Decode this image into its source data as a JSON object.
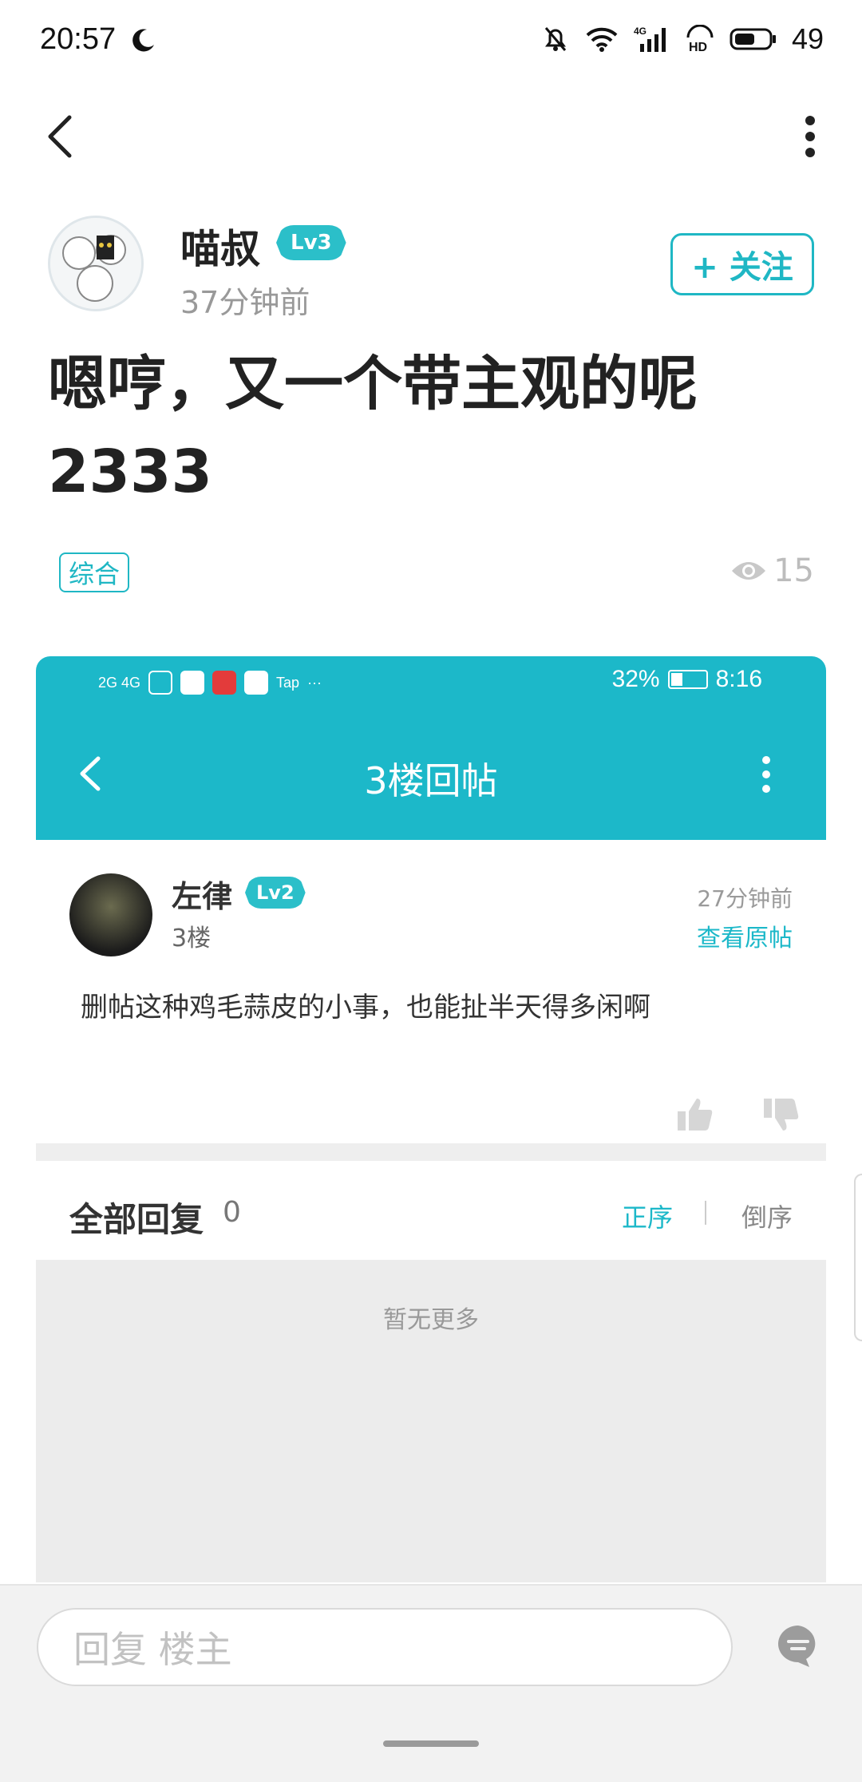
{
  "status_bar": {
    "time": "20:57",
    "network": "4G",
    "hd": "HD",
    "battery": "49"
  },
  "header": {
    "back_icon": "chevron-left-icon",
    "more_icon": "more-vertical-icon"
  },
  "post": {
    "author": {
      "name": "喵叔",
      "level": "Lv3",
      "time_ago": "37分钟前"
    },
    "follow_label": "+ 关注",
    "title": "嗯哼，又一个带主观的呢2333",
    "tag": "综合",
    "views": "15"
  },
  "embedded_screenshot": {
    "status": {
      "signals": "2G 4G",
      "app": "Tap",
      "more": "···",
      "battery": "32%",
      "time": "8:16"
    },
    "title": "3楼回帖",
    "reply": {
      "author": "左律",
      "level": "Lv2",
      "floor": "3楼",
      "time_ago": "27分钟前",
      "view_original": "查看原帖",
      "content": "删帖这种鸡毛蒜皮的小事，也能扯半天得多闲啊"
    },
    "all_replies": {
      "label": "全部回复",
      "count": "0",
      "sort_asc": "正序",
      "sort_desc": "倒序"
    },
    "empty_text": "暂无更多"
  },
  "bottom_bar": {
    "reply_placeholder": "回复  楼主"
  },
  "colors": {
    "accent": "#1fb7c4",
    "header_teal": "#1cb8c9"
  }
}
